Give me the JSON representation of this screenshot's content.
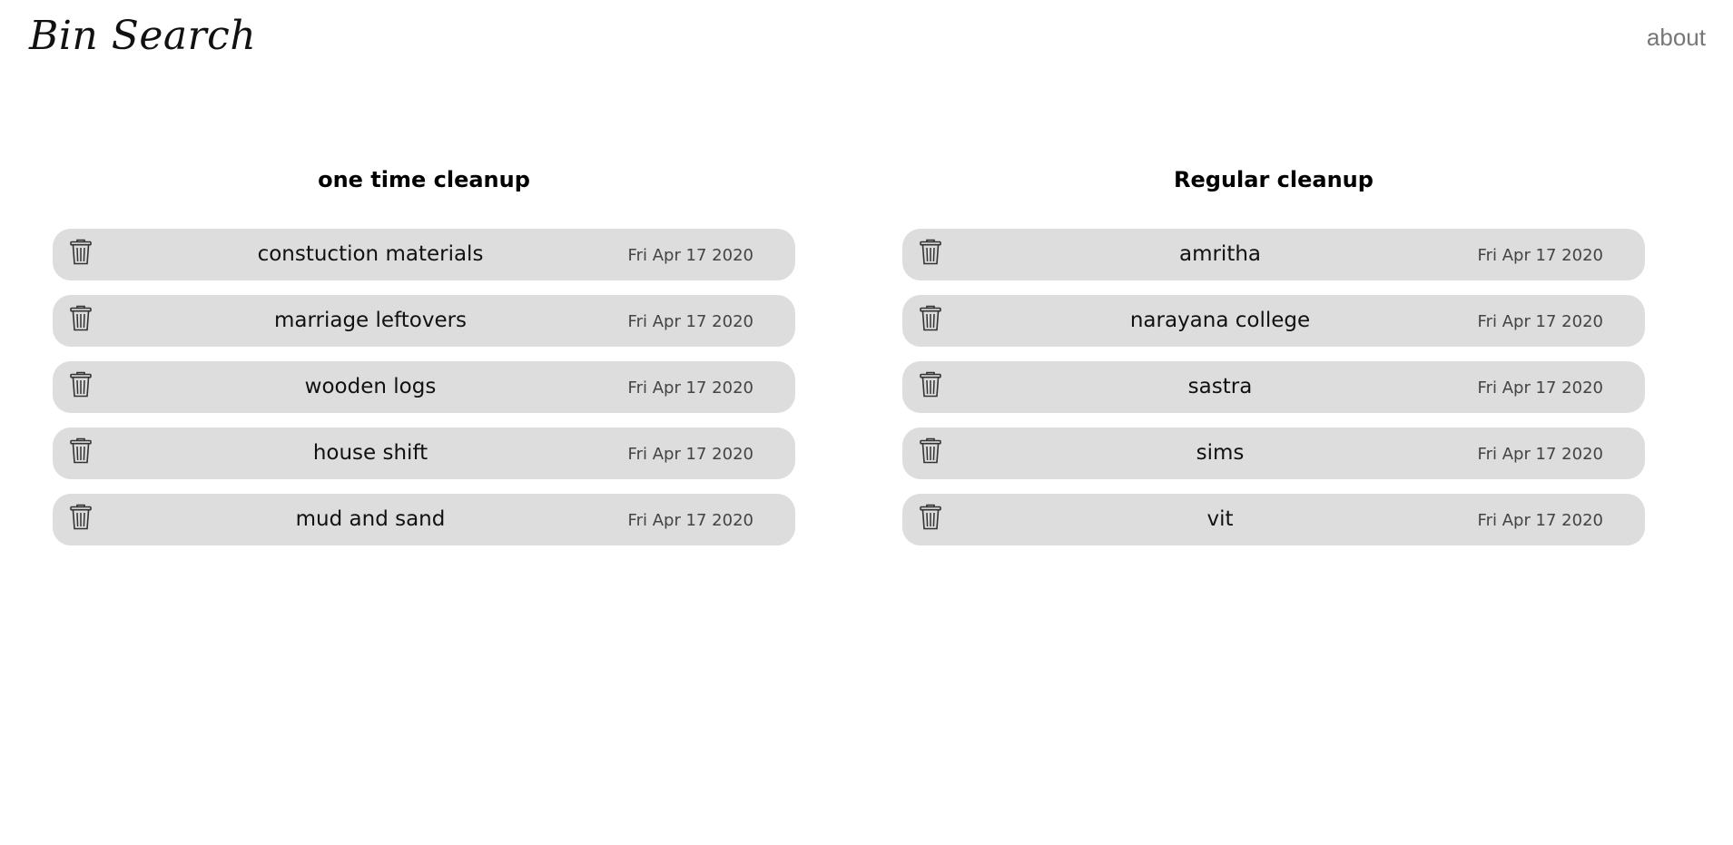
{
  "header": {
    "logo_text": "Bin Search",
    "about_label": "about"
  },
  "columns": [
    {
      "title": "one time cleanup",
      "items": [
        {
          "name": "constuction materials",
          "date": "Fri Apr 17 2020",
          "icon": "trash-icon"
        },
        {
          "name": "marriage leftovers",
          "date": "Fri Apr 17 2020",
          "icon": "trash-icon"
        },
        {
          "name": "wooden logs",
          "date": "Fri Apr 17 2020",
          "icon": "trash-icon"
        },
        {
          "name": "house shift",
          "date": "Fri Apr 17 2020",
          "icon": "trash-icon"
        },
        {
          "name": "mud and sand",
          "date": "Fri Apr 17 2020",
          "icon": "trash-icon"
        }
      ]
    },
    {
      "title": "Regular cleanup",
      "items": [
        {
          "name": "amritha",
          "date": "Fri Apr 17 2020",
          "icon": "trash-icon"
        },
        {
          "name": "narayana college",
          "date": "Fri Apr 17 2020",
          "icon": "trash-icon"
        },
        {
          "name": "sastra",
          "date": "Fri Apr 17 2020",
          "icon": "trash-icon"
        },
        {
          "name": "sims",
          "date": "Fri Apr 17 2020",
          "icon": "trash-icon"
        },
        {
          "name": "vit",
          "date": "Fri Apr 17 2020",
          "icon": "trash-icon"
        }
      ]
    }
  ],
  "colors": {
    "item_background": "#dddddd",
    "about_link": "#777777",
    "date_text": "#444444"
  }
}
